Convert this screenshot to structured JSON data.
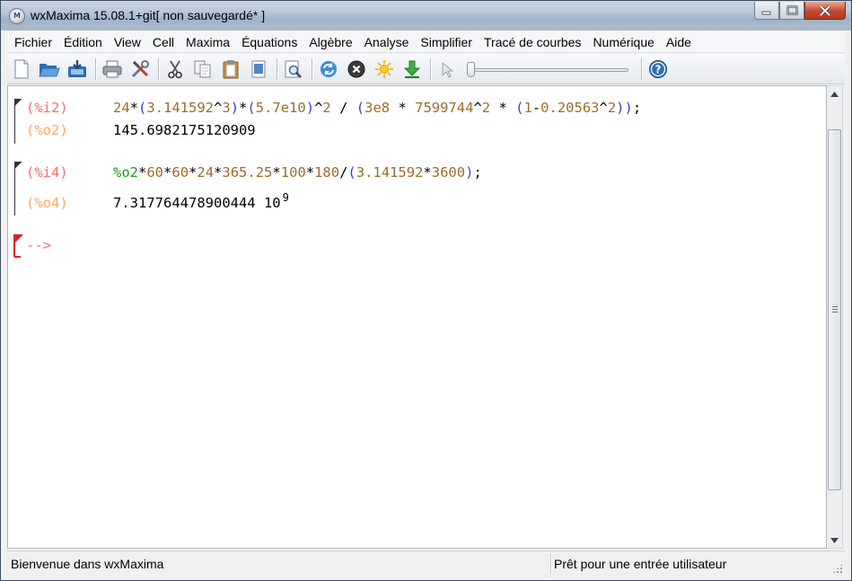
{
  "window": {
    "title": "wxMaxima 15.08.1+git[ non sauvegardé* ]",
    "app_icon_text": "M"
  },
  "menubar": {
    "items": [
      "Fichier",
      "Édition",
      "View",
      "Cell",
      "Maxima",
      "Équations",
      "Algèbre",
      "Analyse",
      "Simplifier",
      "Tracé de courbes",
      "Numérique",
      "Aide"
    ]
  },
  "toolbar": {
    "icons": [
      "new-document-icon",
      "open-folder-icon",
      "save-icon",
      "print-icon",
      "settings-tools-icon",
      "cut-icon",
      "copy-icon",
      "paste-icon",
      "select-all-icon",
      "find-icon",
      "restart-maxima-icon",
      "interrupt-icon",
      "animation-sun-icon",
      "download-arrow-icon",
      "play-pointer-icon",
      "help-icon"
    ],
    "slider_value": 0
  },
  "cells": [
    {
      "input_label": "(%i2)",
      "input_tokens": [
        {
          "t": "24",
          "c": "num"
        },
        {
          "t": "*",
          "c": "op"
        },
        {
          "t": "(",
          "c": "par"
        },
        {
          "t": "3.141592",
          "c": "num"
        },
        {
          "t": "^",
          "c": "op"
        },
        {
          "t": "3",
          "c": "num"
        },
        {
          "t": ")",
          "c": "par"
        },
        {
          "t": "*",
          "c": "op"
        },
        {
          "t": "(",
          "c": "par"
        },
        {
          "t": "5.7e10",
          "c": "num"
        },
        {
          "t": ")",
          "c": "par"
        },
        {
          "t": "^",
          "c": "op"
        },
        {
          "t": "2",
          "c": "num"
        },
        {
          "t": " / ",
          "c": "op"
        },
        {
          "t": "(",
          "c": "par"
        },
        {
          "t": "3e8",
          "c": "num"
        },
        {
          "t": " * ",
          "c": "op"
        },
        {
          "t": "7599744",
          "c": "num"
        },
        {
          "t": "^",
          "c": "op"
        },
        {
          "t": "2",
          "c": "num"
        },
        {
          "t": " * ",
          "c": "op"
        },
        {
          "t": "(",
          "c": "par"
        },
        {
          "t": "1",
          "c": "num"
        },
        {
          "t": "-",
          "c": "op"
        },
        {
          "t": "0.20563",
          "c": "num"
        },
        {
          "t": "^",
          "c": "op"
        },
        {
          "t": "2",
          "c": "num"
        },
        {
          "t": "))",
          "c": "par"
        },
        {
          "t": ";",
          "c": "op"
        }
      ],
      "output_label": "(%o2)",
      "output_value": "145.6982175120909",
      "output_exponent": ""
    },
    {
      "input_label": "(%i4)",
      "input_tokens": [
        {
          "t": "%o2",
          "c": "var"
        },
        {
          "t": "*",
          "c": "op"
        },
        {
          "t": "60",
          "c": "num"
        },
        {
          "t": "*",
          "c": "op"
        },
        {
          "t": "60",
          "c": "num"
        },
        {
          "t": "*",
          "c": "op"
        },
        {
          "t": "24",
          "c": "num"
        },
        {
          "t": "*",
          "c": "op"
        },
        {
          "t": "365.25",
          "c": "num"
        },
        {
          "t": "*",
          "c": "op"
        },
        {
          "t": "100",
          "c": "num"
        },
        {
          "t": "*",
          "c": "op"
        },
        {
          "t": "180",
          "c": "num"
        },
        {
          "t": "/",
          "c": "op"
        },
        {
          "t": "(",
          "c": "par"
        },
        {
          "t": "3.141592",
          "c": "num"
        },
        {
          "t": "*",
          "c": "op"
        },
        {
          "t": "3600",
          "c": "num"
        },
        {
          "t": ")",
          "c": "par"
        },
        {
          "t": ";",
          "c": "op"
        }
      ],
      "output_label": "(%o4)",
      "output_value": "7.317764478900444 10",
      "output_exponent": "9"
    }
  ],
  "prompt": "-->",
  "colors": {
    "input_label": "#ff6a6a",
    "output_label": "#ffa860",
    "number": "#9b6d2b",
    "parenthesis": "#3e3ed8",
    "variable": "#1f9a1f",
    "cursor_bracket": "#e02020"
  },
  "statusbar": {
    "left": "Bienvenue dans wxMaxima",
    "right": "Prêt pour une entrée utilisateur"
  }
}
